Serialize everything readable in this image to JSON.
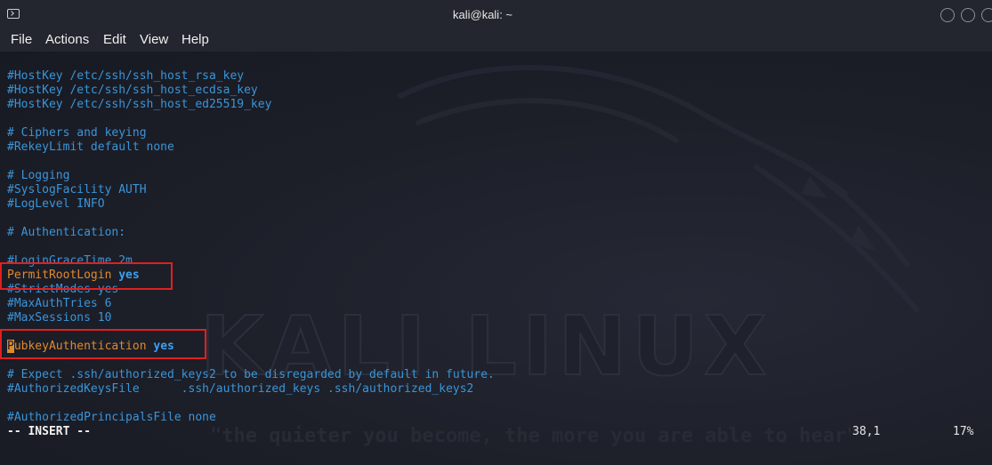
{
  "window": {
    "title": "kali@kali: ~"
  },
  "menu": {
    "file": "File",
    "actions": "Actions",
    "edit": "Edit",
    "view": "View",
    "help": "Help"
  },
  "background": {
    "watermark": "KALI LINUX",
    "tagline": "\"the quieter you become, the more you are able to hear\""
  },
  "editor": {
    "lines": {
      "l1": "#HostKey /etc/ssh/ssh_host_rsa_key",
      "l2": "#HostKey /etc/ssh/ssh_host_ecdsa_key",
      "l3": "#HostKey /etc/ssh/ssh_host_ed25519_key",
      "l5": "# Ciphers and keying",
      "l6": "#RekeyLimit default none",
      "l8": "# Logging",
      "l9": "#SyslogFacility AUTH",
      "l10": "#LogLevel INFO",
      "l12": "# Authentication:",
      "l14": "#LoginGraceTime 2m",
      "l15_key": "PermitRootLogin",
      "l15_val": "yes",
      "l16": "#StrictModes yes",
      "l17": "#MaxAuthTries 6",
      "l18": "#MaxSessions 10",
      "l20_cursor": "P",
      "l20_key": "ubkeyAuthentication",
      "l20_val": "yes",
      "l22": "# Expect .ssh/authorized_keys2 to be disregarded by default in future.",
      "l23": "#AuthorizedKeysFile      .ssh/authorized_keys .ssh/authorized_keys2",
      "l25": "#AuthorizedPrincipalsFile none"
    },
    "status": {
      "mode": "-- INSERT --",
      "position": "38,1",
      "percent": "17%"
    }
  },
  "colors": {
    "comment": "#3a95d8",
    "directive": "#e08a2d",
    "value": "#3aa0f0",
    "highlight_box": "#e02020"
  }
}
